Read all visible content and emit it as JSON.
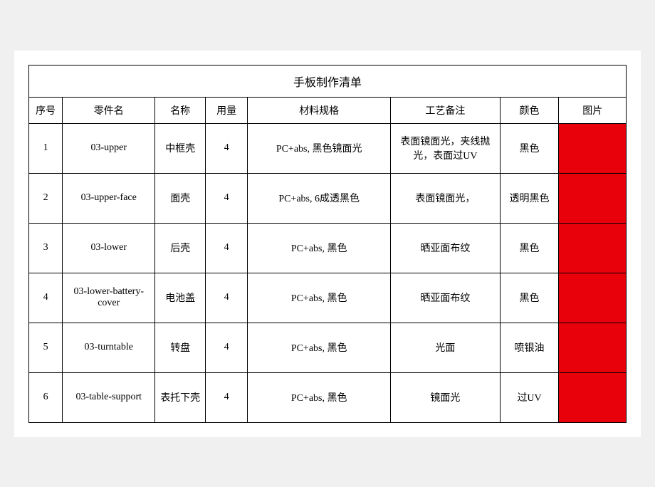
{
  "table": {
    "title": "手板制作清单",
    "headers": [
      "序号",
      "零件名",
      "名称",
      "用量",
      "材料规格",
      "工艺备注",
      "颜色",
      "图片"
    ],
    "rows": [
      {
        "seq": "1",
        "part": "03-upper",
        "name": "中框壳",
        "qty": "4",
        "spec": "PC+abs, 黑色镜面光",
        "craft": "表面镜面光，夹线抛光，表面过UV",
        "color": "黑色",
        "has_img": true
      },
      {
        "seq": "2",
        "part": "03-upper-face",
        "name": "面壳",
        "qty": "4",
        "spec": "PC+abs, 6成透黑色",
        "craft": "表面镜面光，",
        "color": "透明黑色",
        "has_img": true
      },
      {
        "seq": "3",
        "part": "03-lower",
        "name": "后壳",
        "qty": "4",
        "spec": "PC+abs, 黑色",
        "craft": "晒亚面布纹",
        "color": "黑色",
        "has_img": true
      },
      {
        "seq": "4",
        "part": "03-lower-battery-cover",
        "name": "电池盖",
        "qty": "4",
        "spec": "PC+abs, 黑色",
        "craft": "晒亚面布纹",
        "color": "黑色",
        "has_img": true
      },
      {
        "seq": "5",
        "part": "03-turntable",
        "name": "转盘",
        "qty": "4",
        "spec": "PC+abs, 黑色",
        "craft": "光面",
        "color": "喷银油",
        "has_img": true
      },
      {
        "seq": "6",
        "part": "03-table-support",
        "name": "表托下壳",
        "qty": "4",
        "spec": "PC+abs, 黑色",
        "craft": "镜面光",
        "color": "过UV",
        "has_img": true
      }
    ]
  }
}
